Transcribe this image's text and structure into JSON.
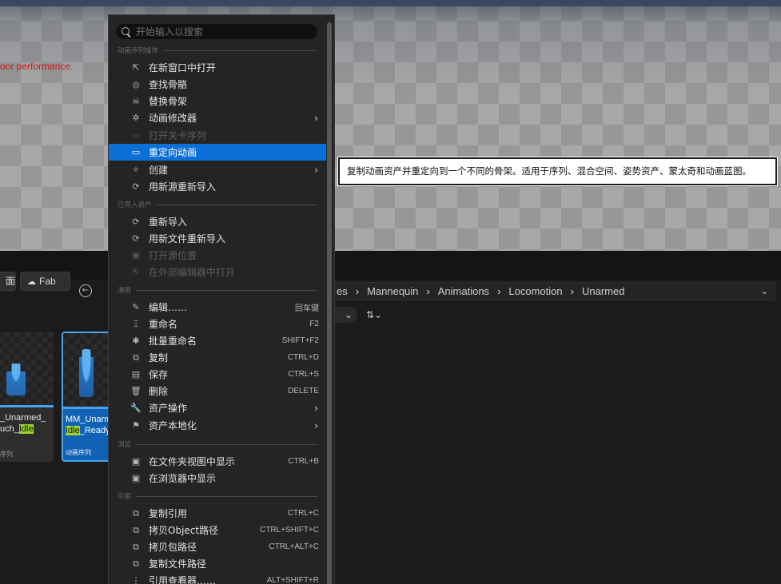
{
  "viewport": {
    "warning_text": "oor performance."
  },
  "tooltip": {
    "text": "复制动画资产并重定向到一个不同的骨架。适用于序列、混合空间、姿势资产、蒙太奇和动画蓝图。"
  },
  "content_browser": {
    "left_button_label": "面",
    "fab_label": "Fab",
    "breadcrumb": [
      "es",
      "Mannequin",
      "Animations",
      "Locomotion",
      "Unarmed"
    ],
    "assets": [
      {
        "name_line1": "_Unarmed_",
        "name_line2_pre": "uch_",
        "name_line2_hl": "Idle",
        "name_line2_post": "",
        "type": "序列"
      },
      {
        "name_line1": "MM_Unarm",
        "name_line2_pre": "",
        "name_line2_hl": "Idle",
        "name_line2_post": "_Ready",
        "type": "动画序列"
      }
    ]
  },
  "menu": {
    "search_placeholder": "开始输入以搜索",
    "sections": {
      "anim_seq": "动画序列操作",
      "imported": "已导入资产",
      "common": "通用",
      "browse": "浏览",
      "reference": "引用"
    },
    "items": {
      "open_new_window": "在新窗口中打开",
      "find_skeleton": "查找骨骼",
      "replace_skeleton": "替换骨架",
      "anim_modifiers": "动画修改器",
      "open_keyframe": "打开关卡序列",
      "retarget": "重定向动画",
      "create": "创建",
      "reimport_new_source": "用新源重新导入",
      "reimport": "重新导入",
      "reimport_new_file": "用新文件重新导入",
      "open_source_location": "打开源位置",
      "open_external_editor": "在外部编辑器中打开",
      "edit": "编辑……",
      "edit_sc": "回车键",
      "rename": "重命名",
      "rename_sc": "F2",
      "batch_rename": "批量重命名",
      "batch_rename_sc": "SHIFT+F2",
      "duplicate": "复制",
      "duplicate_sc": "CTRL+D",
      "save": "保存",
      "save_sc": "CTRL+S",
      "delete": "删除",
      "delete_sc": "DELETE",
      "asset_actions": "资产操作",
      "asset_localization": "资产本地化",
      "show_in_folder": "在文件夹视图中显示",
      "show_in_folder_sc": "CTRL+B",
      "show_in_browser": "在浏览器中显示",
      "copy_reference": "复制引用",
      "copy_reference_sc": "CTRL+C",
      "copy_object_path": "拷贝Object路径",
      "copy_object_path_sc": "CTRL+SHIFT+C",
      "copy_package_path": "拷贝包路径",
      "copy_package_path_sc": "CTRL+ALT+C",
      "copy_file_path": "复制文件路径",
      "reference_viewer": "引用查看器……",
      "reference_viewer_sc": "ALT+SHIFT+R"
    }
  }
}
